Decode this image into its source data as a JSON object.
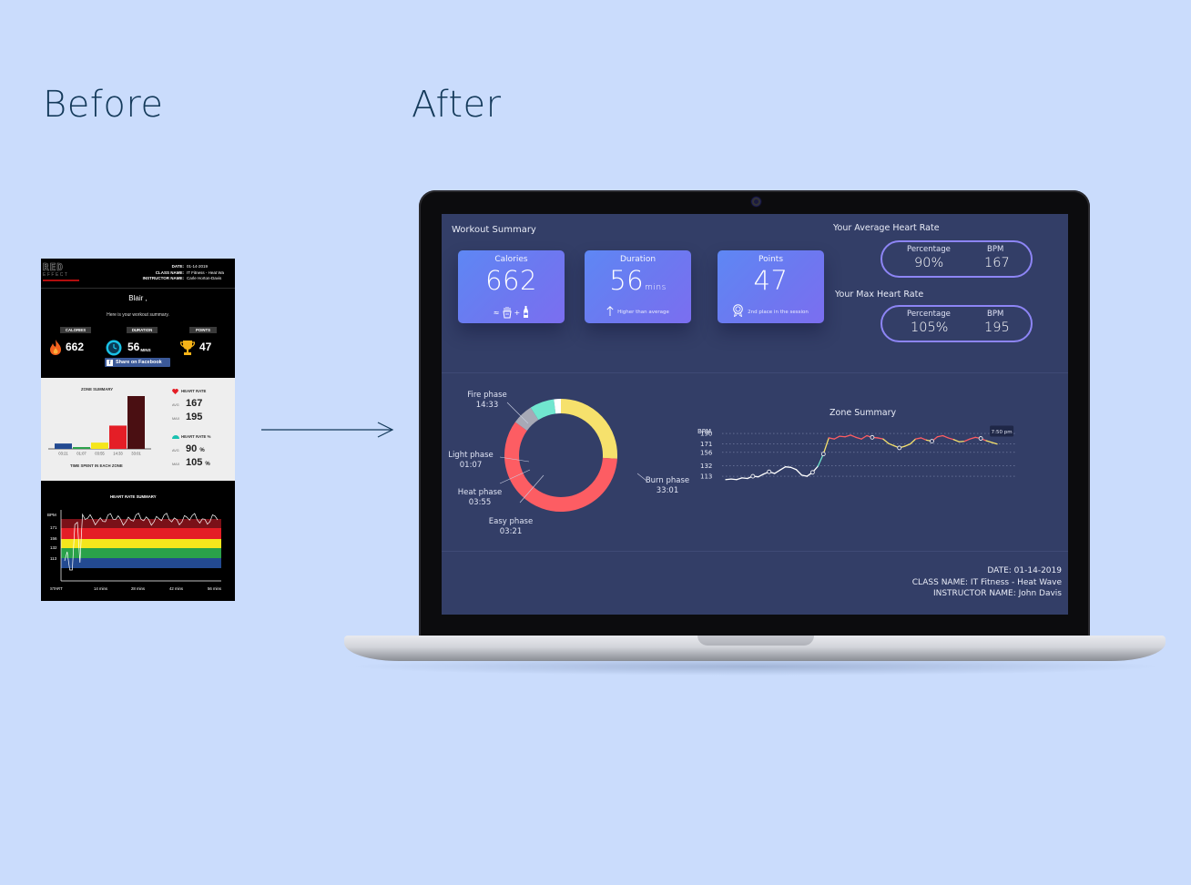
{
  "headings": {
    "before": "Before",
    "after": "After"
  },
  "old_email": {
    "logo": {
      "word": "RED",
      "sub": "EFFECT"
    },
    "meta": [
      {
        "key": "DATE:",
        "value": "01-14-2019"
      },
      {
        "key": "CLASS NAME:",
        "value": "IT Fitness - Heat Wa"
      },
      {
        "key": "INSTRUCTOR NAME:",
        "value": "Carle Horton-Davis"
      }
    ],
    "greeting": "Blair ,",
    "intro": "Here is your workout summary.",
    "labels": {
      "calories": "CALORIES",
      "duration": "DURATION",
      "points": "POINTS"
    },
    "calories": "662",
    "duration": "56",
    "duration_unit": "MINS",
    "points": "47",
    "facebook": "Share on Facebook",
    "zone_title": "ZONE SUMMARY",
    "zone_caption": "TIME SPENT IN EACH ZONE",
    "zones": [
      {
        "time": "03:21",
        "value": 3.35,
        "color": "#234a91"
      },
      {
        "time": "01:07",
        "value": 1.12,
        "color": "#2aa14a"
      },
      {
        "time": "03:55",
        "value": 3.92,
        "color": "#f5e61c"
      },
      {
        "time": "14:33",
        "value": 14.55,
        "color": "#e41e26"
      },
      {
        "time": "33:01",
        "value": 33.02,
        "color": "#4a0f12"
      }
    ],
    "hr_label": "HEART RATE",
    "hr_avg_label": "AVG",
    "hr_avg": "167",
    "hr_max_label": "MAX",
    "hr_max": "195",
    "hrp_label": "HEART RATE %",
    "hrp_avg": "90",
    "hrp_max": "105",
    "pct": "%",
    "hr_summary_title": "HEART RATE SUMMARY",
    "bpm_axis": "BPM",
    "bpm_ticks": [
      "171",
      "156",
      "132",
      "113"
    ],
    "time_ticks": [
      "START",
      "14 mins",
      "28 mins",
      "42 mins",
      "56 mins"
    ]
  },
  "dashboard": {
    "title": "Workout Summary",
    "cards": [
      {
        "label": "Calories",
        "value": "662",
        "unit": "",
        "note": ""
      },
      {
        "label": "Duration",
        "value": "56",
        "unit": "mins",
        "note": "Higher than average"
      },
      {
        "label": "Points",
        "value": "47",
        "unit": "",
        "note": "2nd place in the session"
      }
    ],
    "cal_equation": {
      "approx": "≈",
      "plus": "+"
    },
    "avg_hr": {
      "title": "Your Average Heart Rate",
      "pct_label": "Percentage",
      "pct": "90%",
      "bpm_label": "BPM",
      "bpm": "167"
    },
    "max_hr": {
      "title": "Your Max Heart Rate",
      "pct_label": "Percentage",
      "pct": "105%",
      "bpm_label": "BPM",
      "bpm": "195"
    },
    "phases": [
      {
        "name": "Fire phase",
        "time": "14:33",
        "minutes": 14.55,
        "color": "#f6e16c"
      },
      {
        "name": "Burn phase",
        "time": "33:01",
        "minutes": 33.02,
        "color": "#fd5d63"
      },
      {
        "name": "Easy phase",
        "time": "03:21",
        "minutes": 3.35,
        "color": "#a7a9b6"
      },
      {
        "name": "Heat phase",
        "time": "03:55",
        "minutes": 3.92,
        "color": "#71e6cf"
      },
      {
        "name": "Light phase",
        "time": "01:07",
        "minutes": 1.12,
        "color": "#ffffff"
      }
    ],
    "zone_summary_title": "Zone Summary",
    "footer": {
      "date": "DATE: 01-14-2019",
      "class_name": "CLASS NAME: IT Fitness - Heat Wave",
      "instructor": "INSTRUCTOR NAME: John Davis"
    }
  },
  "chart_data": {
    "type": "line",
    "title": "Zone Summary",
    "ylabel": "BPM",
    "yticks": [
      190,
      171,
      156,
      132,
      113
    ],
    "ylim": [
      100,
      195
    ],
    "grid": true,
    "tooltip": "7:50 pm",
    "x": [
      0,
      2,
      4,
      6,
      8,
      10,
      12,
      14,
      16,
      18,
      20,
      22,
      24,
      26,
      28,
      30,
      32,
      34,
      36,
      38,
      40,
      42,
      44,
      46,
      48,
      50,
      52,
      54,
      56,
      58,
      60,
      62,
      64,
      66,
      68,
      70,
      72,
      74,
      76,
      78,
      80,
      82,
      84,
      86,
      88,
      90,
      92,
      94,
      96,
      98,
      100
    ],
    "y": [
      107,
      108,
      107,
      110,
      109,
      113,
      112,
      117,
      121,
      118,
      124,
      130,
      129,
      125,
      115,
      113,
      120,
      131,
      153,
      182,
      180,
      185,
      184,
      187,
      183,
      180,
      186,
      183,
      182,
      180,
      172,
      168,
      164,
      167,
      171,
      180,
      182,
      178,
      176,
      184,
      186,
      182,
      179,
      175,
      176,
      180,
      183,
      181,
      177,
      174,
      171
    ],
    "zone_colors": {
      "easy": "#ffffff",
      "heat": "#71e6cf",
      "fire": "#f6e16c",
      "burn": "#fd5d63"
    },
    "grid_color": "#7e88ad"
  }
}
